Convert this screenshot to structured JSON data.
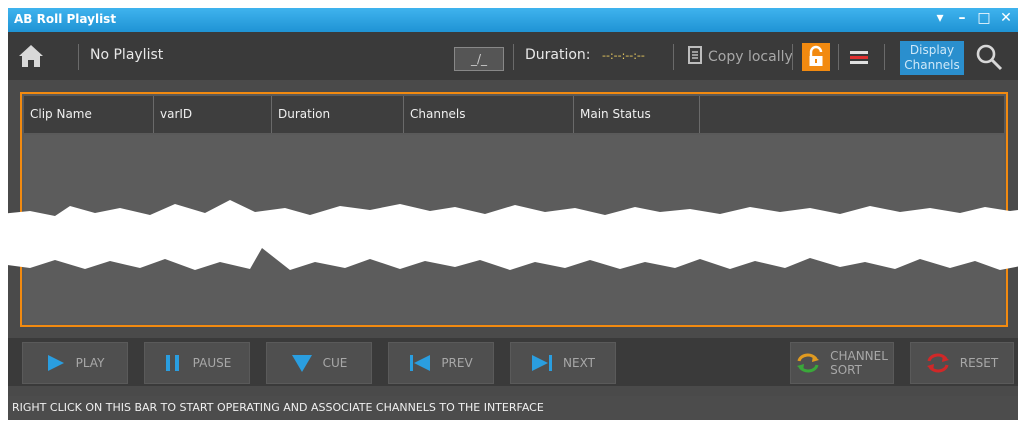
{
  "window": {
    "title": "AB Roll Playlist",
    "controls": [
      "▾",
      "–",
      "□",
      "✕"
    ]
  },
  "toolbar": {
    "home_icon": "home-icon",
    "playlist_name": "No Playlist",
    "date_box": "_/_",
    "duration_label": "Duration:",
    "duration_value": "--:--:--:--",
    "copy_label": "Copy locally",
    "lock_icon": "lock-icon",
    "menu_icon": "menu-icon",
    "display_channels_line1": "Display",
    "display_channels_line2": "Channels",
    "search_icon": "search-icon"
  },
  "grid": {
    "columns": [
      "Clip Name",
      "varID",
      "Duration",
      "Channels",
      "Main Status",
      ""
    ]
  },
  "transport": {
    "play": "PLAY",
    "pause": "PAUSE",
    "cue": "CUE",
    "prev": "PREV",
    "next": "NEXT",
    "channel_sort_line1": "CHANNEL",
    "channel_sort_line2": "SORT",
    "reset": "RESET"
  },
  "status_bar": {
    "text": "RIGHT CLICK ON THIS BAR TO START OPERATING AND ASSOCIATE CHANNELS TO THE INTERFACE"
  },
  "colors": {
    "title_bar": "#2aa3e4",
    "accent_orange": "#f28a10",
    "play_blue": "#2a9ee0",
    "display_blue": "#2a8fce"
  }
}
